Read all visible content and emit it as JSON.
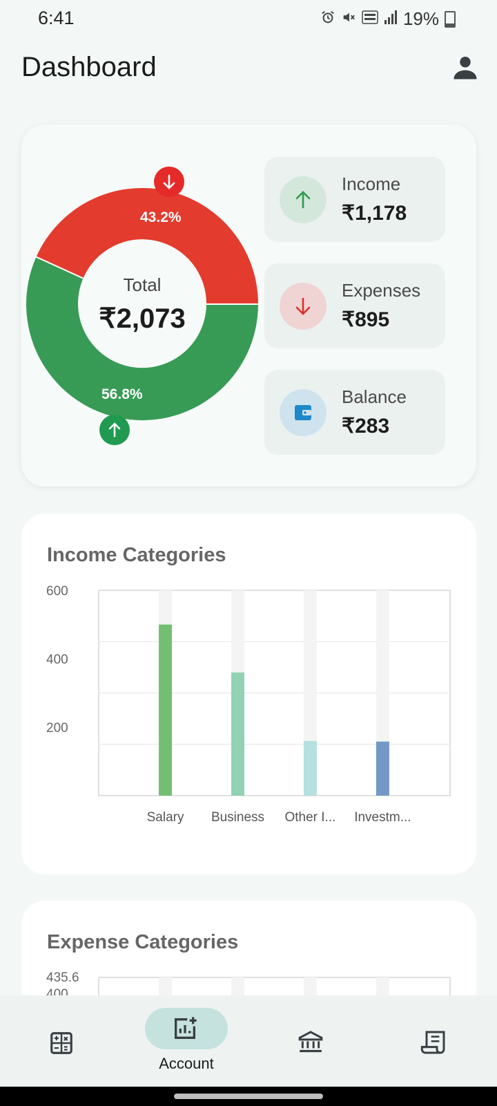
{
  "status_bar": {
    "time": "6:41",
    "battery": "19%"
  },
  "header": {
    "title": "Dashboard"
  },
  "summary": {
    "total_label": "Total",
    "total_value": "₹2,073",
    "expense_pct": "43.2%",
    "income_pct": "56.8%",
    "income": {
      "label": "Income",
      "value": "₹1,178"
    },
    "expenses": {
      "label": "Expenses",
      "value": "₹895"
    },
    "balance": {
      "label": "Balance",
      "value": "₹283"
    }
  },
  "colors": {
    "income": "#379b56",
    "expense": "#e33b2e",
    "balance": "#1f88c9"
  },
  "income_chart": {
    "title": "Income Categories"
  },
  "expense_chart": {
    "title": "Expense Categories"
  },
  "chart_data": [
    {
      "type": "bar",
      "title": "Income Categories",
      "categories": [
        "Salary",
        "Business",
        "Other I...",
        "Investm..."
      ],
      "values": [
        500,
        360,
        160,
        158
      ],
      "ylim": [
        0,
        600
      ],
      "yticks": [
        200,
        400,
        600
      ],
      "colors": [
        "#72bf74",
        "#92d1b3",
        "#b6dfe0",
        "#7398c6"
      ],
      "grid": true
    },
    {
      "type": "bar",
      "title": "Expense Categories",
      "categories": [],
      "values": [],
      "ylim": [
        0,
        435.6
      ],
      "yticks": [
        400,
        435.6
      ],
      "grid": true
    }
  ],
  "bottom_nav": {
    "items": [
      {
        "icon": "calculator-icon",
        "label": ""
      },
      {
        "icon": "add-chart-icon",
        "label": "Account",
        "active": true
      },
      {
        "icon": "bank-icon",
        "label": ""
      },
      {
        "icon": "receipt-icon",
        "label": ""
      }
    ]
  }
}
